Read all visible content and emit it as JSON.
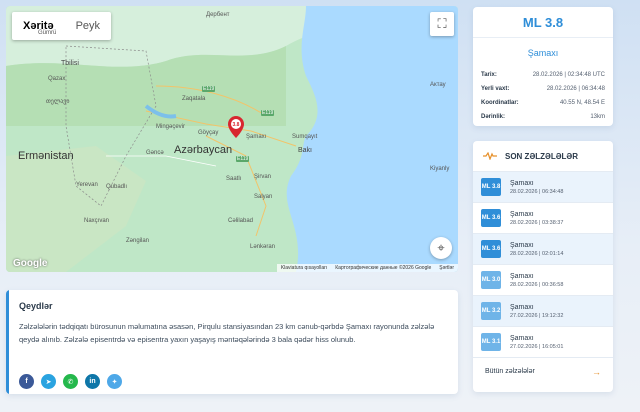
{
  "map": {
    "tabs": [
      {
        "label": "Xəritə",
        "active": true
      },
      {
        "label": "Peyk",
        "active": false
      }
    ],
    "fullscreen_icon": "fullscreen-icon",
    "locate_icon": "crosshair-icon",
    "labels": {
      "country_az": "Azərbaycan",
      "country_am": "Ermənistan",
      "tbilisi": "Tbilisi",
      "baki": "Bakı",
      "samaxi": "Şamaxı",
      "mingacevir": "Mingəçevir",
      "goycay": "Göyçay",
      "gence": "Gəncə",
      "sirvan": "Şirvan",
      "saatli": "Saatlı",
      "salyan": "Salyan",
      "celilabad": "Cəlilabad",
      "lenkeran": "Lənkəran",
      "naxcivan": "Naxçıvan",
      "qazax": "Qazax",
      "zaqatala": "Zaqatala",
      "sumqayit": "Sumqayıt",
      "derbent": "Дербент",
      "aktau": "Актау",
      "qubadli": "Qubadlı",
      "zengilan": "Zəngilan",
      "yerevan": "Yerevan",
      "kiyanly": "Kiyanly",
      "gumru": "Gümrü",
      "telavi": "თელავი",
      "pin_mag": "3.8"
    },
    "google": "Google",
    "attribution": [
      "Klaviatura qısayolları",
      "Картографические данные ©2026 Google",
      "Şərtlər"
    ]
  },
  "quake": {
    "title": "ML 3.8",
    "place": "Şamaxı",
    "rows": [
      {
        "k": "Tarix:",
        "v": "28.02.2026 | 02:34:48 UTC"
      },
      {
        "k": "Yerli vaxt:",
        "v": "28.02.2026 | 06:34:48"
      },
      {
        "k": "Koordinatlar:",
        "v": "40.55 N, 48.54 E"
      },
      {
        "k": "Dərinlik:",
        "v": "13km"
      }
    ]
  },
  "recent": {
    "title": "SON ZƏLZƏLƏLƏR",
    "icon": "seismograph-icon",
    "items": [
      {
        "mag": "ML 3.8",
        "place": "Şamaxı",
        "time": "28.02.2026 | 06:34:48"
      },
      {
        "mag": "ML 3.6",
        "place": "Şamaxı",
        "time": "28.02.2026 | 03:38:37"
      },
      {
        "mag": "ML 3.6",
        "place": "Şamaxı",
        "time": "28.02.2026 | 02:01:14"
      },
      {
        "mag": "ML 3.0",
        "place": "Şamaxı",
        "time": "28.02.2026 | 00:36:58"
      },
      {
        "mag": "ML 3.2",
        "place": "Şamaxı",
        "time": "27.02.2026 | 19:12:32"
      },
      {
        "mag": "ML 3.1",
        "place": "Şamaxı",
        "time": "27.02.2026 | 16:05:01"
      }
    ],
    "all_label": "Bütün zəlzələlər",
    "arrow": "→"
  },
  "notes": {
    "title": "Qeydlər",
    "text": "Zəlzələlərin tədqiqatı bürosunun məlumatına əsasən, Pirqulu stansiyasından 23 km cənub-qərbdə Şamaxı rayonunda zəlzələ qeydə alınıb. Zəlzələ episentrdə və episentra yaxın yaşayış məntəqələrində 3 bala qədər hiss olunub.",
    "share": [
      {
        "name": "facebook-icon",
        "glyph": "f",
        "color": "#3b5998"
      },
      {
        "name": "telegram-icon",
        "glyph": "➤",
        "color": "#2aa3e0"
      },
      {
        "name": "whatsapp-icon",
        "glyph": "✆",
        "color": "#25b84c"
      },
      {
        "name": "linkedin-icon",
        "glyph": "in",
        "color": "#0e76a8"
      },
      {
        "name": "twitter-icon",
        "glyph": "✦",
        "color": "#4ea8e8"
      }
    ]
  }
}
